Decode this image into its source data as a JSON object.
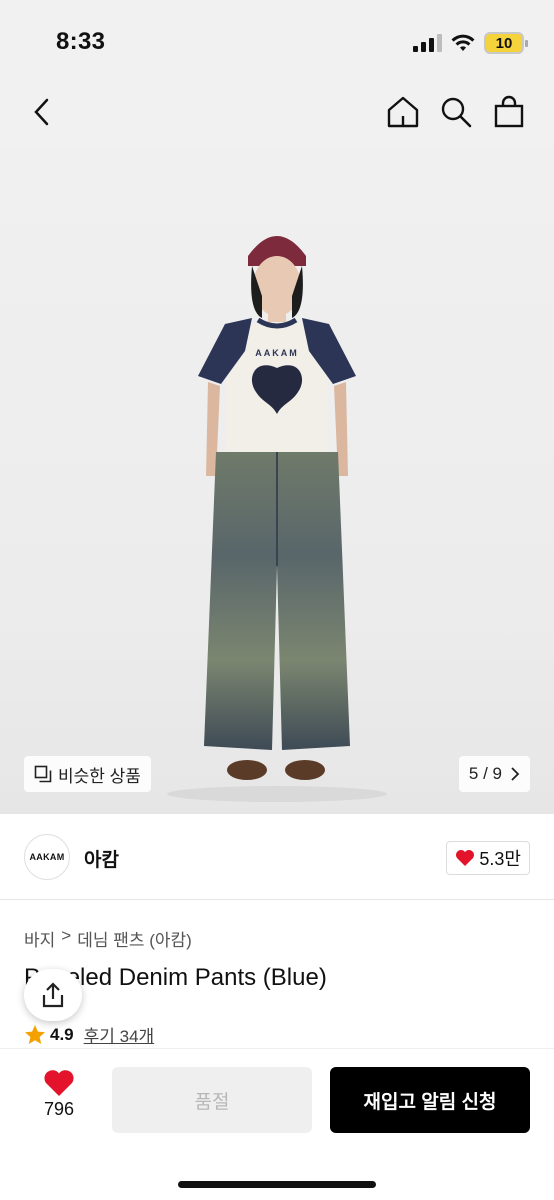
{
  "status": {
    "time": "8:33",
    "battery": "10"
  },
  "gallery": {
    "similar_label": "비슷한 상품",
    "page": "5 / 9"
  },
  "brand": {
    "logo_text": "AAKAM",
    "name": "아캄",
    "likes": "5.3만"
  },
  "breadcrumb": [
    "바지",
    ">",
    "데님 팬츠 (아캄)"
  ],
  "product": {
    "title": "Paneled Denim Pants (Blue)",
    "rating": "4.9",
    "reviews": "후기 34개"
  },
  "bottom": {
    "wish_count": "796",
    "soldout_label": "품절",
    "restock_label": "재입고 알림 신청"
  },
  "colors": {
    "accent": "#e3132b",
    "star": "#f4a000",
    "cta": "#000000"
  }
}
